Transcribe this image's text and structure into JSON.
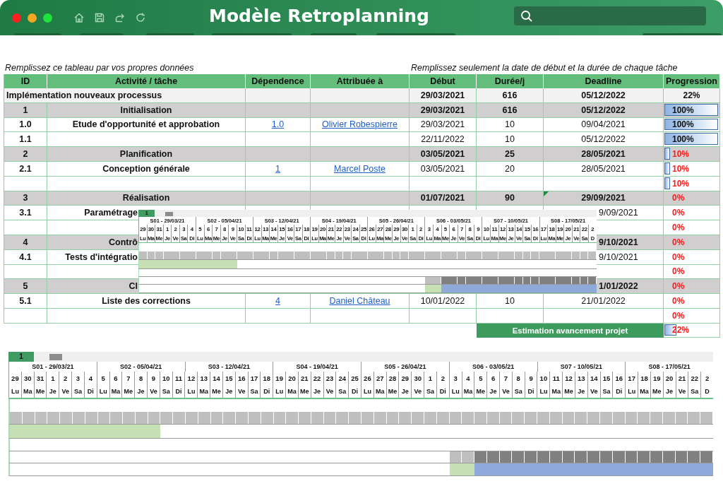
{
  "window": {
    "title": "Modèle Retroplanning"
  },
  "captions": [
    "Remplissez ce tableau par vos propres données",
    "Remplissez seulement la date de début et la durée de chaque tâche"
  ],
  "table": {
    "columns": [
      "ID",
      "Activité / tâche",
      "Dépendence",
      "Attribuée à",
      "Début",
      "Durée/j",
      "Deadline",
      "Progression"
    ],
    "rows": [
      {
        "kind": "summary",
        "activity": "Implémentation nouveaux processus",
        "start": "29/03/2021",
        "duration": "616",
        "deadline": "05/12/2022",
        "progress": {
          "text": "22%",
          "alert": false
        },
        "covered": false,
        "comment_marker": false
      },
      {
        "kind": "phase",
        "id": "1",
        "activity": "Initialisation",
        "start": "29/03/2021",
        "duration": "616",
        "deadline": "05/12/2022",
        "progress": {
          "text": "100%",
          "level": 1,
          "alert": false
        },
        "covered": false,
        "comment_marker": false
      },
      {
        "kind": "task",
        "id": "1.0",
        "activity": "Etude d'opportunité et approbation",
        "dependence": "1.0",
        "assignee": "Olivier Robespierre",
        "start": "29/03/2021",
        "duration": "10",
        "deadline": "09/04/2021",
        "progress": {
          "text": "100%",
          "level": 1,
          "alert": false
        },
        "covered": false,
        "comment_marker": false
      },
      {
        "kind": "task",
        "id": "1.1",
        "start": "22/11/2022",
        "duration": "10",
        "deadline": "05/12/2022",
        "progress": {
          "text": "100%",
          "level": 1,
          "alert": false
        },
        "covered": false,
        "comment_marker": false
      },
      {
        "kind": "phase",
        "id": "2",
        "activity": "Planification",
        "start": "03/05/2021",
        "duration": "25",
        "deadline": "28/05/2021",
        "progress": {
          "text": "10%",
          "level": 0.1,
          "alert": true
        },
        "covered": false,
        "comment_marker": false
      },
      {
        "kind": "task",
        "id": "2.1",
        "activity": "Conception générale",
        "dependence": "1",
        "assignee": "Marcel Poste",
        "start": "03/05/2021",
        "duration": "20",
        "deadline": "28/05/2021",
        "progress": {
          "text": "10%",
          "level": 0.1,
          "alert": true
        },
        "covered": false,
        "comment_marker": false
      },
      {
        "kind": "empty",
        "progress": {
          "text": "10%",
          "level": 0.1,
          "alert": true
        },
        "covered": false,
        "comment_marker": false
      },
      {
        "kind": "phase",
        "id": "3",
        "activity": "Réalisation",
        "start": "01/07/2021",
        "duration": "90",
        "deadline": "29/09/2021",
        "progress": {
          "text": "0%",
          "alert": true
        },
        "covered": false,
        "comment_marker": true
      },
      {
        "kind": "task",
        "id": "3.1",
        "activity": "Paramétrage",
        "deadline": "9/09/2021",
        "progress": {
          "text": "0%",
          "alert": true
        },
        "covered": true,
        "comment_marker": false
      },
      {
        "kind": "empty",
        "progress": {
          "text": "0%",
          "alert": true
        },
        "covered": true,
        "comment_marker": false
      },
      {
        "kind": "phase",
        "id": "4",
        "activity": "Contrô",
        "deadline": "9/10/2021",
        "progress": {
          "text": "0%",
          "alert": true
        },
        "covered": true,
        "comment_marker": false
      },
      {
        "kind": "task",
        "id": "4.1",
        "activity": "Tests d'intégratio",
        "deadline": "9/10/2021",
        "progress": {
          "text": "0%",
          "alert": true
        },
        "covered": true,
        "comment_marker": false
      },
      {
        "kind": "empty",
        "progress": {
          "text": "0%",
          "alert": true
        },
        "covered": true,
        "comment_marker": false
      },
      {
        "kind": "phase",
        "id": "5",
        "activity": "Cl",
        "deadline": "1/01/2022",
        "progress": {
          "text": "0%",
          "alert": true
        },
        "covered": true,
        "comment_marker": false
      },
      {
        "kind": "task",
        "id": "5.1",
        "activity": "Liste des corrections",
        "dependence": "4",
        "assignee": "Daniel Château",
        "start": "10/01/2022",
        "duration": "10",
        "deadline": "21/01/2022",
        "progress": {
          "text": "0%",
          "alert": true
        },
        "covered": false,
        "comment_marker": false
      },
      {
        "kind": "empty",
        "progress": {
          "text": "0%",
          "alert": true
        },
        "covered": false,
        "comment_marker": false
      }
    ],
    "footer": {
      "label": "Estimation avancement projet",
      "progress": {
        "text": "22%",
        "level": 0.22,
        "alert": true
      }
    }
  },
  "gantt": {
    "tabs": [
      {
        "label": "1",
        "selected": true
      },
      {
        "selected": false
      }
    ],
    "weeks": [
      "S01 - 29/03/21",
      "S02 - 05/04/21",
      "S03 - 12/04/21",
      "S04 - 19/04/21",
      "S05 - 26/04/21",
      "S06 - 03/05/21",
      "S07 - 10/05/21",
      "S08 - 17/05/21"
    ],
    "day_numbers": [
      "29",
      "30",
      "31",
      "1",
      "2",
      "3",
      "4",
      "5",
      "6",
      "7",
      "8",
      "9",
      "10",
      "11",
      "12",
      "13",
      "14",
      "15",
      "16",
      "17",
      "18",
      "19",
      "20",
      "21",
      "22",
      "23",
      "24",
      "25",
      "26",
      "27",
      "28",
      "29",
      "30",
      "1",
      "2",
      "3",
      "4",
      "5",
      "6",
      "7",
      "8",
      "9",
      "10",
      "11",
      "12",
      "13",
      "14",
      "15",
      "16",
      "17",
      "18",
      "19",
      "20",
      "21",
      "22",
      "2"
    ],
    "day_names": [
      "Lu",
      "Ma",
      "Me",
      "Je",
      "Ve",
      "Sa",
      "Di",
      "Lu",
      "Ma",
      "Me",
      "Je",
      "Ve",
      "Sa",
      "Di",
      "Lu",
      "Ma",
      "Me",
      "Je",
      "Ve",
      "Sa",
      "Di",
      "Lu",
      "Ma",
      "Me",
      "Je",
      "Ve",
      "Sa",
      "Di",
      "Lu",
      "Ma",
      "Me",
      "Je",
      "Ve",
      "Sa",
      "Di",
      "Lu",
      "Ma",
      "Me",
      "Je",
      "Ve",
      "Sa",
      "Di",
      "Lu",
      "Ma",
      "Me",
      "Je",
      "Ve",
      "Sa",
      "Di",
      "Lu",
      "Ma",
      "Me",
      "Je",
      "Ve",
      "Sa",
      "D"
    ],
    "rows": [
      {
        "kind": "blank"
      },
      {
        "kind": "cells",
        "cells": [
          {
            "kind": "grid"
          },
          {
            "kind": "grid"
          },
          {
            "kind": "grid"
          },
          {
            "kind": "grid"
          },
          {
            "kind": "grid"
          },
          {
            "kind": "grid"
          },
          {
            "kind": "grid"
          },
          {
            "kind": "grid"
          },
          {
            "kind": "grid"
          },
          {
            "kind": "grid"
          },
          {
            "kind": "grid"
          },
          {
            "kind": "grid"
          },
          {
            "kind": "grid"
          },
          {
            "kind": "grid"
          },
          {
            "kind": "grid"
          },
          {
            "kind": "grid"
          },
          {
            "kind": "grid"
          },
          {
            "kind": "grid"
          },
          {
            "kind": "grid"
          },
          {
            "kind": "grid"
          },
          {
            "kind": "grid"
          },
          {
            "kind": "grid"
          },
          {
            "kind": "grid"
          },
          {
            "kind": "grid"
          },
          {
            "kind": "grid"
          },
          {
            "kind": "grid"
          },
          {
            "kind": "grid"
          },
          {
            "kind": "grid"
          },
          {
            "kind": "grid"
          },
          {
            "kind": "grid"
          },
          {
            "kind": "grid"
          },
          {
            "kind": "grid"
          },
          {
            "kind": "grid"
          },
          {
            "kind": "grid"
          },
          {
            "kind": "grid"
          },
          {
            "kind": "grid"
          },
          {
            "kind": "grid"
          },
          {
            "kind": "grid"
          },
          {
            "kind": "grid"
          },
          {
            "kind": "grid"
          },
          {
            "kind": "grid"
          },
          {
            "kind": "grid"
          },
          {
            "kind": "grid"
          },
          {
            "kind": "grid"
          },
          {
            "kind": "grid"
          },
          {
            "kind": "grid"
          },
          {
            "kind": "grid"
          },
          {
            "kind": "grid"
          },
          {
            "kind": "grid"
          },
          {
            "kind": "grid"
          },
          {
            "kind": "grid"
          },
          {
            "kind": "grid"
          },
          {
            "kind": "grid"
          },
          {
            "kind": "grid"
          },
          {
            "kind": "grid"
          },
          {
            "kind": "grid"
          }
        ]
      },
      {
        "kind": "cells",
        "cells": [
          {
            "kind": "done"
          },
          {
            "kind": "done"
          },
          {
            "kind": "done"
          },
          {
            "kind": "done"
          },
          {
            "kind": "done"
          },
          {
            "kind": "done"
          },
          {
            "kind": "done"
          },
          {
            "kind": "done"
          },
          {
            "kind": "done"
          },
          {
            "kind": "done"
          },
          {
            "kind": "done"
          },
          {
            "kind": "done"
          },
          {
            "kind": "none"
          },
          {
            "kind": "none"
          },
          {
            "kind": "none"
          },
          {
            "kind": "none"
          },
          {
            "kind": "none"
          },
          {
            "kind": "none"
          },
          {
            "kind": "none"
          },
          {
            "kind": "none"
          },
          {
            "kind": "none"
          },
          {
            "kind": "none"
          },
          {
            "kind": "none"
          },
          {
            "kind": "none"
          },
          {
            "kind": "none"
          },
          {
            "kind": "none"
          },
          {
            "kind": "none"
          },
          {
            "kind": "none"
          },
          {
            "kind": "none"
          },
          {
            "kind": "none"
          },
          {
            "kind": "none"
          },
          {
            "kind": "none"
          },
          {
            "kind": "none"
          },
          {
            "kind": "none"
          },
          {
            "kind": "none"
          },
          {
            "kind": "none"
          },
          {
            "kind": "none"
          },
          {
            "kind": "none"
          },
          {
            "kind": "none"
          },
          {
            "kind": "none"
          },
          {
            "kind": "none"
          },
          {
            "kind": "none"
          },
          {
            "kind": "none"
          },
          {
            "kind": "none"
          },
          {
            "kind": "none"
          },
          {
            "kind": "none"
          },
          {
            "kind": "none"
          },
          {
            "kind": "none"
          },
          {
            "kind": "none"
          },
          {
            "kind": "none"
          },
          {
            "kind": "none"
          },
          {
            "kind": "none"
          },
          {
            "kind": "none"
          },
          {
            "kind": "none"
          },
          {
            "kind": "none"
          },
          {
            "kind": "none"
          }
        ]
      },
      {
        "kind": "blank"
      },
      {
        "kind": "cells",
        "cells": [
          {
            "kind": "none"
          },
          {
            "kind": "none"
          },
          {
            "kind": "none"
          },
          {
            "kind": "none"
          },
          {
            "kind": "none"
          },
          {
            "kind": "none"
          },
          {
            "kind": "none"
          },
          {
            "kind": "none"
          },
          {
            "kind": "none"
          },
          {
            "kind": "none"
          },
          {
            "kind": "none"
          },
          {
            "kind": "none"
          },
          {
            "kind": "none"
          },
          {
            "kind": "none"
          },
          {
            "kind": "none"
          },
          {
            "kind": "none"
          },
          {
            "kind": "none"
          },
          {
            "kind": "none"
          },
          {
            "kind": "none"
          },
          {
            "kind": "none"
          },
          {
            "kind": "none"
          },
          {
            "kind": "none"
          },
          {
            "kind": "none"
          },
          {
            "kind": "none"
          },
          {
            "kind": "none"
          },
          {
            "kind": "none"
          },
          {
            "kind": "none"
          },
          {
            "kind": "none"
          },
          {
            "kind": "none"
          },
          {
            "kind": "none"
          },
          {
            "kind": "none"
          },
          {
            "kind": "none"
          },
          {
            "kind": "none"
          },
          {
            "kind": "none"
          },
          {
            "kind": "none"
          },
          {
            "kind": "grid"
          },
          {
            "kind": "grid"
          },
          {
            "kind": "dark"
          },
          {
            "kind": "dark"
          },
          {
            "kind": "dark"
          },
          {
            "kind": "dark"
          },
          {
            "kind": "dark"
          },
          {
            "kind": "dark"
          },
          {
            "kind": "dark"
          },
          {
            "kind": "dark"
          },
          {
            "kind": "dark"
          },
          {
            "kind": "dark"
          },
          {
            "kind": "dark"
          },
          {
            "kind": "dark"
          },
          {
            "kind": "dark"
          },
          {
            "kind": "dark"
          },
          {
            "kind": "dark"
          },
          {
            "kind": "dark"
          },
          {
            "kind": "dark"
          },
          {
            "kind": "dark"
          },
          {
            "kind": "dark"
          }
        ]
      },
      {
        "kind": "cells",
        "cells": [
          {
            "kind": "none"
          },
          {
            "kind": "none"
          },
          {
            "kind": "none"
          },
          {
            "kind": "none"
          },
          {
            "kind": "none"
          },
          {
            "kind": "none"
          },
          {
            "kind": "none"
          },
          {
            "kind": "none"
          },
          {
            "kind": "none"
          },
          {
            "kind": "none"
          },
          {
            "kind": "none"
          },
          {
            "kind": "none"
          },
          {
            "kind": "none"
          },
          {
            "kind": "none"
          },
          {
            "kind": "none"
          },
          {
            "kind": "none"
          },
          {
            "kind": "none"
          },
          {
            "kind": "none"
          },
          {
            "kind": "none"
          },
          {
            "kind": "none"
          },
          {
            "kind": "none"
          },
          {
            "kind": "none"
          },
          {
            "kind": "none"
          },
          {
            "kind": "none"
          },
          {
            "kind": "none"
          },
          {
            "kind": "none"
          },
          {
            "kind": "none"
          },
          {
            "kind": "none"
          },
          {
            "kind": "none"
          },
          {
            "kind": "none"
          },
          {
            "kind": "none"
          },
          {
            "kind": "none"
          },
          {
            "kind": "none"
          },
          {
            "kind": "none"
          },
          {
            "kind": "none"
          },
          {
            "kind": "done"
          },
          {
            "kind": "done"
          },
          {
            "kind": "plan"
          },
          {
            "kind": "plan"
          },
          {
            "kind": "plan"
          },
          {
            "kind": "plan"
          },
          {
            "kind": "plan"
          },
          {
            "kind": "plan"
          },
          {
            "kind": "plan"
          },
          {
            "kind": "plan"
          },
          {
            "kind": "plan"
          },
          {
            "kind": "plan"
          },
          {
            "kind": "plan"
          },
          {
            "kind": "plan"
          },
          {
            "kind": "plan"
          },
          {
            "kind": "plan"
          },
          {
            "kind": "plan"
          },
          {
            "kind": "plan"
          },
          {
            "kind": "plan"
          },
          {
            "kind": "plan"
          },
          {
            "kind": "plan"
          }
        ]
      }
    ]
  },
  "gantt_preview": {
    "tabs": [
      {
        "label": "1",
        "selected": true
      },
      {
        "selected": false
      }
    ],
    "weeks": [
      "S01 - 29/03/21",
      "S02 - 05/04/21",
      "S03 - 12/04/21",
      "S04 - 19/04/21",
      "S05 - 26/04/21",
      "S06 - 03/05/21",
      "S07 - 10/05/21",
      "S08 - 17/05/21"
    ],
    "day_numbers": [
      "29",
      "30",
      "31",
      "1",
      "2",
      "3",
      "4",
      "5",
      "6",
      "7",
      "8",
      "9",
      "10",
      "11",
      "12",
      "13",
      "14",
      "15",
      "16",
      "17",
      "18",
      "19",
      "20",
      "21",
      "22",
      "23",
      "24",
      "25",
      "26",
      "27",
      "28",
      "29",
      "30",
      "1",
      "2",
      "3",
      "4",
      "5",
      "6",
      "7",
      "8",
      "9",
      "10",
      "11",
      "12",
      "13",
      "14",
      "15",
      "16",
      "17",
      "18",
      "19",
      "20",
      "21",
      "22",
      "2"
    ],
    "day_names": [
      "Lu",
      "Ma",
      "Me",
      "Je",
      "Ve",
      "Sa",
      "Di",
      "Lu",
      "Ma",
      "Me",
      "Je",
      "Ve",
      "Sa",
      "Di",
      "Lu",
      "Ma",
      "Me",
      "Je",
      "Ve",
      "Sa",
      "Di",
      "Lu",
      "Ma",
      "Me",
      "Je",
      "Ve",
      "Sa",
      "Di",
      "Lu",
      "Ma",
      "Me",
      "Je",
      "Ve",
      "Sa",
      "Di",
      "Lu",
      "Ma",
      "Me",
      "Je",
      "Ve",
      "Sa",
      "Di",
      "Lu",
      "Ma",
      "Me",
      "Je",
      "Ve",
      "Sa",
      "Di",
      "Lu",
      "Ma",
      "Me",
      "Je",
      "Ve",
      "Sa",
      "D"
    ],
    "rows": [
      {
        "kind": "blank"
      },
      {
        "kind": "cells",
        "cells": [
          {
            "kind": "grid"
          },
          {
            "kind": "grid"
          },
          {
            "kind": "grid"
          },
          {
            "kind": "grid"
          },
          {
            "kind": "grid"
          },
          {
            "kind": "grid"
          },
          {
            "kind": "grid"
          },
          {
            "kind": "grid"
          },
          {
            "kind": "grid"
          },
          {
            "kind": "grid"
          },
          {
            "kind": "grid"
          },
          {
            "kind": "grid"
          },
          {
            "kind": "grid"
          },
          {
            "kind": "grid"
          },
          {
            "kind": "grid"
          },
          {
            "kind": "grid"
          },
          {
            "kind": "grid"
          },
          {
            "kind": "grid"
          },
          {
            "kind": "grid"
          },
          {
            "kind": "grid"
          },
          {
            "kind": "grid"
          },
          {
            "kind": "grid"
          },
          {
            "kind": "grid"
          },
          {
            "kind": "grid"
          },
          {
            "kind": "grid"
          },
          {
            "kind": "grid"
          },
          {
            "kind": "grid"
          },
          {
            "kind": "grid"
          },
          {
            "kind": "grid"
          },
          {
            "kind": "grid"
          },
          {
            "kind": "grid"
          },
          {
            "kind": "grid"
          },
          {
            "kind": "grid"
          },
          {
            "kind": "grid"
          },
          {
            "kind": "grid"
          },
          {
            "kind": "grid"
          },
          {
            "kind": "grid"
          },
          {
            "kind": "grid"
          },
          {
            "kind": "grid"
          },
          {
            "kind": "grid"
          },
          {
            "kind": "grid"
          },
          {
            "kind": "grid"
          },
          {
            "kind": "grid"
          },
          {
            "kind": "grid"
          },
          {
            "kind": "grid"
          },
          {
            "kind": "grid"
          },
          {
            "kind": "grid"
          },
          {
            "kind": "grid"
          },
          {
            "kind": "grid"
          },
          {
            "kind": "grid"
          },
          {
            "kind": "grid"
          },
          {
            "kind": "grid"
          },
          {
            "kind": "grid"
          },
          {
            "kind": "grid"
          },
          {
            "kind": "grid"
          },
          {
            "kind": "grid"
          }
        ]
      },
      {
        "kind": "cells",
        "cells": [
          {
            "kind": "done"
          },
          {
            "kind": "done"
          },
          {
            "kind": "done"
          },
          {
            "kind": "done"
          },
          {
            "kind": "done"
          },
          {
            "kind": "done"
          },
          {
            "kind": "done"
          },
          {
            "kind": "done"
          },
          {
            "kind": "done"
          },
          {
            "kind": "done"
          },
          {
            "kind": "done"
          },
          {
            "kind": "done"
          },
          {
            "kind": "none"
          },
          {
            "kind": "none"
          },
          {
            "kind": "none"
          },
          {
            "kind": "none"
          },
          {
            "kind": "none"
          },
          {
            "kind": "none"
          },
          {
            "kind": "none"
          },
          {
            "kind": "none"
          },
          {
            "kind": "none"
          },
          {
            "kind": "none"
          },
          {
            "kind": "none"
          },
          {
            "kind": "none"
          },
          {
            "kind": "none"
          },
          {
            "kind": "none"
          },
          {
            "kind": "none"
          },
          {
            "kind": "none"
          },
          {
            "kind": "none"
          },
          {
            "kind": "none"
          },
          {
            "kind": "none"
          },
          {
            "kind": "none"
          },
          {
            "kind": "none"
          },
          {
            "kind": "none"
          },
          {
            "kind": "none"
          },
          {
            "kind": "none"
          },
          {
            "kind": "none"
          },
          {
            "kind": "none"
          },
          {
            "kind": "none"
          },
          {
            "kind": "none"
          },
          {
            "kind": "none"
          },
          {
            "kind": "none"
          },
          {
            "kind": "none"
          },
          {
            "kind": "none"
          },
          {
            "kind": "none"
          },
          {
            "kind": "none"
          },
          {
            "kind": "none"
          },
          {
            "kind": "none"
          },
          {
            "kind": "none"
          },
          {
            "kind": "none"
          },
          {
            "kind": "none"
          },
          {
            "kind": "none"
          },
          {
            "kind": "none"
          },
          {
            "kind": "none"
          },
          {
            "kind": "none"
          },
          {
            "kind": "none"
          }
        ]
      },
      {
        "kind": "blank"
      },
      {
        "kind": "cells",
        "cells": [
          {
            "kind": "none"
          },
          {
            "kind": "none"
          },
          {
            "kind": "none"
          },
          {
            "kind": "none"
          },
          {
            "kind": "none"
          },
          {
            "kind": "none"
          },
          {
            "kind": "none"
          },
          {
            "kind": "none"
          },
          {
            "kind": "none"
          },
          {
            "kind": "none"
          },
          {
            "kind": "none"
          },
          {
            "kind": "none"
          },
          {
            "kind": "none"
          },
          {
            "kind": "none"
          },
          {
            "kind": "none"
          },
          {
            "kind": "none"
          },
          {
            "kind": "none"
          },
          {
            "kind": "none"
          },
          {
            "kind": "none"
          },
          {
            "kind": "none"
          },
          {
            "kind": "none"
          },
          {
            "kind": "none"
          },
          {
            "kind": "none"
          },
          {
            "kind": "none"
          },
          {
            "kind": "none"
          },
          {
            "kind": "none"
          },
          {
            "kind": "none"
          },
          {
            "kind": "none"
          },
          {
            "kind": "none"
          },
          {
            "kind": "none"
          },
          {
            "kind": "none"
          },
          {
            "kind": "none"
          },
          {
            "kind": "none"
          },
          {
            "kind": "none"
          },
          {
            "kind": "none"
          },
          {
            "kind": "grid"
          },
          {
            "kind": "grid"
          },
          {
            "kind": "dark"
          },
          {
            "kind": "dark"
          },
          {
            "kind": "dark"
          },
          {
            "kind": "dark"
          },
          {
            "kind": "dark"
          },
          {
            "kind": "dark"
          },
          {
            "kind": "dark"
          },
          {
            "kind": "dark"
          },
          {
            "kind": "dark"
          },
          {
            "kind": "dark"
          },
          {
            "kind": "dark"
          },
          {
            "kind": "dark"
          },
          {
            "kind": "dark"
          },
          {
            "kind": "dark"
          },
          {
            "kind": "dark"
          },
          {
            "kind": "dark"
          },
          {
            "kind": "dark"
          },
          {
            "kind": "dark"
          },
          {
            "kind": "dark"
          }
        ]
      },
      {
        "kind": "cells",
        "cells": [
          {
            "kind": "none"
          },
          {
            "kind": "none"
          },
          {
            "kind": "none"
          },
          {
            "kind": "none"
          },
          {
            "kind": "none"
          },
          {
            "kind": "none"
          },
          {
            "kind": "none"
          },
          {
            "kind": "none"
          },
          {
            "kind": "none"
          },
          {
            "kind": "none"
          },
          {
            "kind": "none"
          },
          {
            "kind": "none"
          },
          {
            "kind": "none"
          },
          {
            "kind": "none"
          },
          {
            "kind": "none"
          },
          {
            "kind": "none"
          },
          {
            "kind": "none"
          },
          {
            "kind": "none"
          },
          {
            "kind": "none"
          },
          {
            "kind": "none"
          },
          {
            "kind": "none"
          },
          {
            "kind": "none"
          },
          {
            "kind": "none"
          },
          {
            "kind": "none"
          },
          {
            "kind": "none"
          },
          {
            "kind": "none"
          },
          {
            "kind": "none"
          },
          {
            "kind": "none"
          },
          {
            "kind": "none"
          },
          {
            "kind": "none"
          },
          {
            "kind": "none"
          },
          {
            "kind": "none"
          },
          {
            "kind": "none"
          },
          {
            "kind": "none"
          },
          {
            "kind": "none"
          },
          {
            "kind": "done"
          },
          {
            "kind": "done"
          },
          {
            "kind": "plan"
          },
          {
            "kind": "plan"
          },
          {
            "kind": "plan"
          },
          {
            "kind": "plan"
          },
          {
            "kind": "plan"
          },
          {
            "kind": "plan"
          },
          {
            "kind": "plan"
          },
          {
            "kind": "plan"
          },
          {
            "kind": "plan"
          },
          {
            "kind": "plan"
          },
          {
            "kind": "plan"
          },
          {
            "kind": "plan"
          },
          {
            "kind": "plan"
          },
          {
            "kind": "plan"
          },
          {
            "kind": "plan"
          },
          {
            "kind": "plan"
          },
          {
            "kind": "plan"
          },
          {
            "kind": "plan"
          },
          {
            "kind": "plan"
          }
        ]
      }
    ]
  }
}
